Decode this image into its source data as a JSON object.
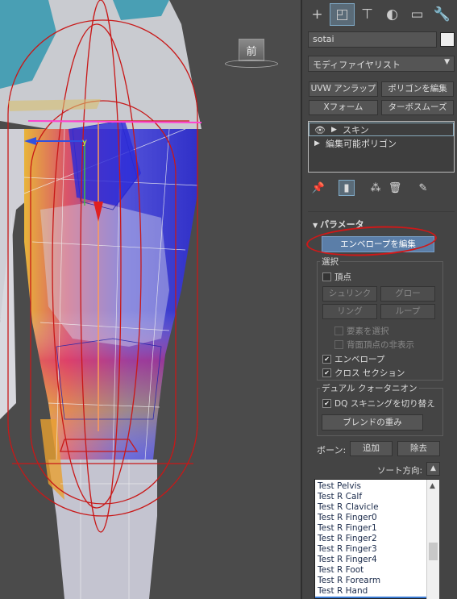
{
  "viewport": {
    "view_label": "前"
  },
  "panel": {
    "tabs": [
      {
        "icon": "create-plus-icon",
        "glyph": "+"
      },
      {
        "icon": "modify-icon",
        "glyph": "◰"
      },
      {
        "icon": "hierarchy-icon",
        "glyph": "⊤"
      },
      {
        "icon": "motion-icon",
        "glyph": "◐"
      },
      {
        "icon": "display-icon",
        "glyph": "▭"
      },
      {
        "icon": "utilities-wrench-icon",
        "glyph": "🔧"
      }
    ],
    "object_name": "sotai",
    "object_color": "#eeeeee",
    "modifier_list": "モディファイヤリスト",
    "quick_buttons": [
      "UVW アンラップ",
      "ポリゴンを編集",
      "Xフォーム",
      "ターボスムーズ"
    ],
    "stack": [
      {
        "label": "スキン"
      },
      {
        "label": "編集可能ポリゴン"
      }
    ],
    "rollout_title": "パラメータ",
    "edit_envelope_button": "エンベロープを編集",
    "selection": {
      "title": "選択",
      "vertices": "頂点",
      "shrink": "シュリンク",
      "grow": "グロー",
      "ring": "リング",
      "loop": "ループ",
      "select_element": "要素を選択",
      "backface_cull": "背面頂点の非表示",
      "envelopes": "エンベロープ",
      "cross_sections": "クロス セクション"
    },
    "dual_quat": {
      "title": "デュアル クォータニオン",
      "dq_toggle": "DQ スキニングを切り替え",
      "blend_weights": "ブレンドの重み"
    },
    "bones": {
      "label": "ボーン:",
      "add": "追加",
      "remove": "除去",
      "sort_label": "ソート方向:",
      "list": [
        "Test Pelvis",
        "Test R Calf",
        "Test R Clavicle",
        "Test R Finger0",
        "Test R Finger1",
        "Test R Finger2",
        "Test R Finger3",
        "Test R Finger4",
        "Test R Foot",
        "Test R Forearm",
        "Test R Hand"
      ],
      "selected_index": 11
    }
  },
  "colors": {
    "accent": "#3a7bd5",
    "annotation": "#d01818",
    "active_tab": "#5a6b78"
  }
}
